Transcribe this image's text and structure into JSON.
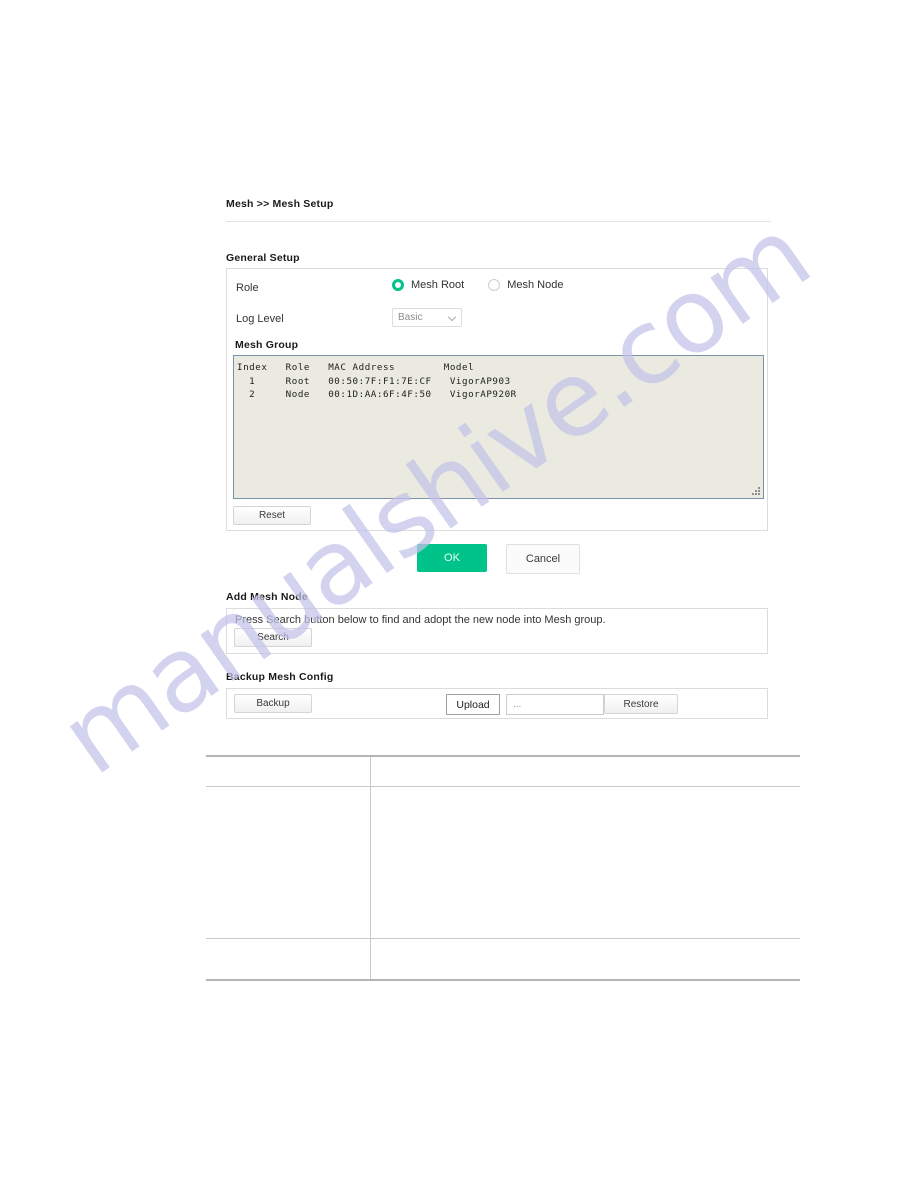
{
  "breadcrumb": "Mesh >> Mesh Setup",
  "general_setup": {
    "title": "General Setup",
    "role": {
      "label": "Role",
      "options": [
        {
          "label": "Mesh Root",
          "selected": true
        },
        {
          "label": "Mesh Node",
          "selected": false
        }
      ]
    },
    "log_level": {
      "label": "Log Level",
      "value": "Basic"
    },
    "reset_label": "Reset"
  },
  "mesh_group": {
    "title": "Mesh Group",
    "columns": [
      "Index",
      "Role",
      "MAC Address",
      "Model"
    ],
    "rows": [
      {
        "index": "1",
        "role": "Root",
        "mac": "00:50:7F:F1:7E:CF",
        "model": "VigorAP903"
      },
      {
        "index": "2",
        "role": "Node",
        "mac": "00:1D:AA:6F:4F:50",
        "model": "VigorAP920R"
      }
    ],
    "text": "Index   Role   MAC Address        Model\n  1     Root   00:50:7F:F1:7E:CF   VigorAP903\n  2     Node   00:1D:AA:6F:4F:50   VigorAP920R"
  },
  "actions": {
    "ok_label": "OK",
    "cancel_label": "Cancel"
  },
  "add_mesh_node": {
    "title": "Add Mesh Node",
    "description": "Press Search button below to find and adopt the new node into Mesh group.",
    "search_label": "Search"
  },
  "backup_mesh_config": {
    "title": "Backup Mesh Config",
    "backup_label": "Backup",
    "upload_label": "Upload",
    "file_placeholder": "...",
    "restore_label": "Restore"
  },
  "doc_table": {
    "rows": [
      {
        "left": "",
        "right": ""
      },
      {
        "left": "",
        "right": ""
      },
      {
        "left": "",
        "right": ""
      }
    ]
  },
  "watermark": {
    "text": "manualshive.com"
  },
  "colors": {
    "accent": "#00c389",
    "panel_border": "#dcdcdc",
    "textarea_bg": "#eaeae0",
    "textarea_border": "#7a93ad",
    "watermark": "#c3c3e9"
  }
}
